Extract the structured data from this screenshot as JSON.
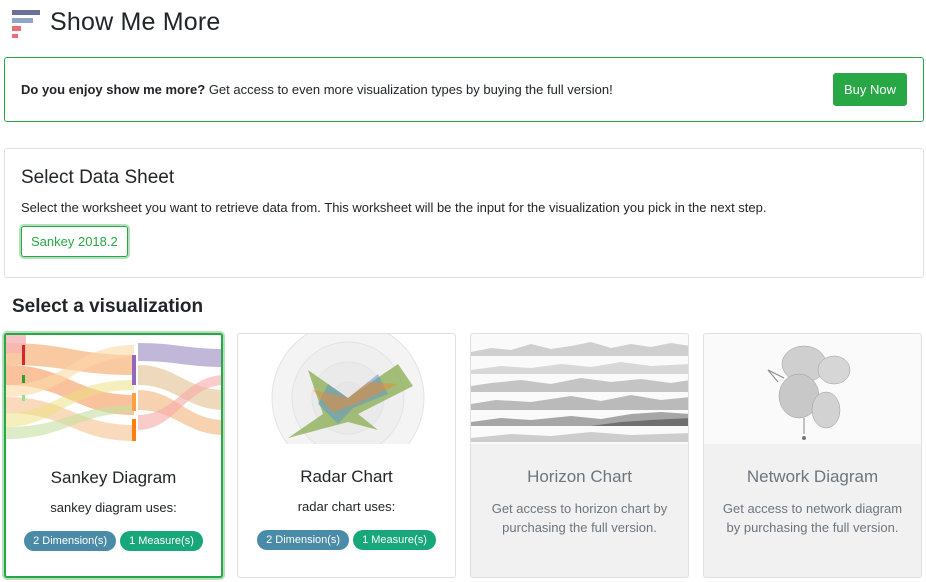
{
  "app": {
    "title": "Show Me More",
    "logo_colors": [
      "#6b6f9a",
      "#8fa6c8",
      "#e76f7a"
    ]
  },
  "promo": {
    "bold_text": "Do you enjoy show me more?",
    "text": " Get access to even more visualization types by buying the full version!",
    "button_label": "Buy Now"
  },
  "data_sheet": {
    "title": "Select Data Sheet",
    "description": "Select the worksheet you want to retrieve data from. This worksheet will be the input for the visualization you pick in the next step.",
    "selected_sheet": "Sankey 2018.2"
  },
  "visualizations": {
    "section_title": "Select a visualization",
    "items": [
      {
        "title": "Sankey Diagram",
        "uses": "sankey diagram uses:",
        "dimensions": "2 Dimension(s)",
        "measures": "1 Measure(s)",
        "state": "selected"
      },
      {
        "title": "Radar Chart",
        "uses": "radar chart uses:",
        "dimensions": "2 Dimension(s)",
        "measures": "1 Measure(s)",
        "state": "available"
      },
      {
        "title": "Horizon Chart",
        "locked_text": "Get access to horizon chart by purchasing the full version.",
        "state": "locked"
      },
      {
        "title": "Network Diagram",
        "locked_text": "Get access to network diagram by purchasing the full version.",
        "state": "locked"
      }
    ]
  },
  "colors": {
    "accent_green": "#28a745",
    "dimension_badge": "#4a8ba8",
    "measure_badge": "#17a77a"
  }
}
